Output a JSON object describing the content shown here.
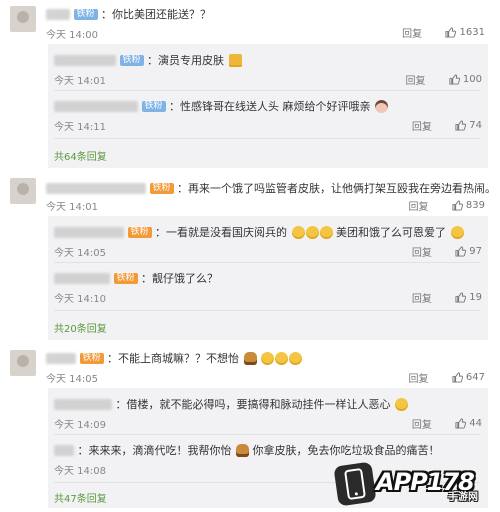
{
  "comments": [
    {
      "badge": "铁粉",
      "text": "：你比美团还能送？？",
      "time": "今天 14:00",
      "reply_label": "回复",
      "likes": "1631",
      "replies": [
        {
          "badge": "铁粉",
          "text": "：演员专用皮肤",
          "time": "今天 14:01",
          "reply_label": "回复",
          "likes": "100"
        },
        {
          "badge": "铁粉",
          "text": "：性感锋哥在线送人头 麻烦给个好评哦亲",
          "time": "今天 14:11",
          "reply_label": "回复",
          "likes": "74"
        }
      ],
      "more": "共64条回复"
    },
    {
      "badge": "铁粉",
      "text": "：再来一个饿了吗监管者皮肤，让他俩打架互殴我在旁边看热闹。",
      "time": "今天 14:01",
      "reply_label": "回复",
      "likes": "839",
      "replies": [
        {
          "badge": "铁粉",
          "text_a": "：一看就是没看国庆阅兵的",
          "text_b": "美团和饿了么可恩爱了",
          "time": "今天 14:05",
          "reply_label": "回复",
          "likes": "97"
        },
        {
          "badge": "铁粉",
          "text": "：靓仔饿了么？",
          "time": "今天 14:10",
          "reply_label": "回复",
          "likes": "19"
        }
      ],
      "more": "共20条回复"
    },
    {
      "badge": "铁粉",
      "text": "：不能上商城嘛？？不想怡",
      "time": "今天 14:05",
      "reply_label": "回复",
      "likes": "647",
      "replies": [
        {
          "text": "：借楼，就不能必得吗，要搞得和脉动挂件一样让人恶心",
          "time": "今天 14:09",
          "reply_label": "回复",
          "likes": "44"
        },
        {
          "text": "：来来来，滴滴代吃！我帮你怡",
          "text_b": "你拿皮肤，免去你吃垃圾食品的痛苦！",
          "time": "今天 14:08",
          "reply_label": "回复",
          "likes": ""
        }
      ],
      "more": "共47条回复"
    }
  ],
  "watermark": {
    "brand": "APP178",
    "sub": "手游网"
  },
  "colors": {
    "reply_bg": "#f2f2f5",
    "more_link": "#5a9a3c",
    "badge_blue": "#7fb3e6",
    "badge_orange": "#f39a38"
  }
}
